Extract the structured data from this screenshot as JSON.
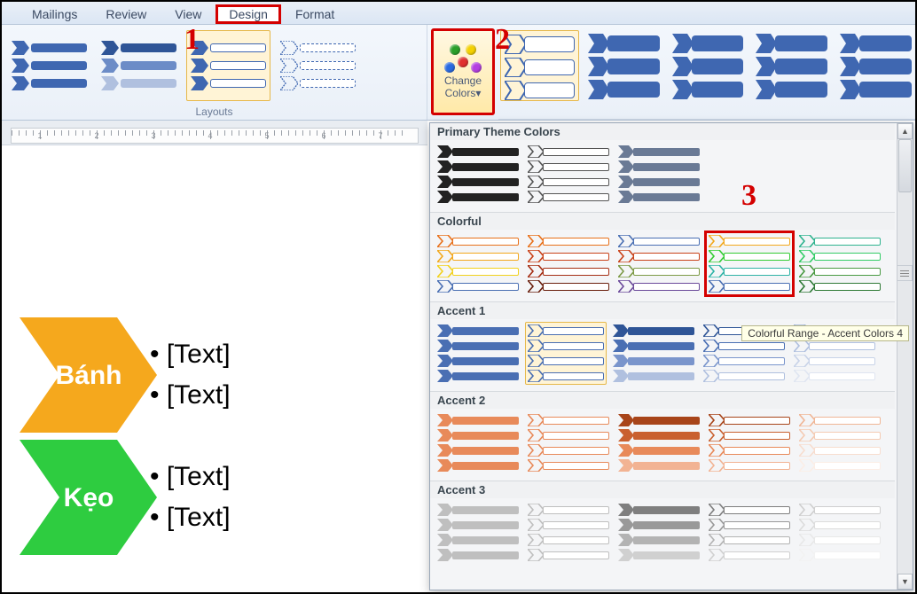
{
  "tabs": {
    "mailings": "Mailings",
    "review": "Review",
    "view": "View",
    "design": "Design",
    "format": "Format"
  },
  "ribbon": {
    "layouts_label": "Layouts",
    "change_colors_l1": "Change",
    "change_colors_l2": "Colors▾"
  },
  "annotations": {
    "n1": "1",
    "n2": "2",
    "n3": "3"
  },
  "panel": {
    "cat_primary": "Primary Theme Colors",
    "cat_colorful": "Colorful",
    "cat_accent1": "Accent 1",
    "cat_accent2": "Accent 2",
    "cat_accent3": "Accent 3",
    "tooltip": "Colorful Range - Accent Colors 4",
    "colorful": [
      [
        "#e8701a",
        "#f2a81d",
        "#f2d11d",
        "#4a6fb3"
      ],
      [
        "#e8701a",
        "#c9421a",
        "#a52f14",
        "#6a1f0d"
      ],
      [
        "#4a6fb3",
        "#c9421a",
        "#7d9a46",
        "#6b4a9a"
      ],
      [
        "#f2a81d",
        "#33cc33",
        "#2fb3a6",
        "#4a6fb3"
      ],
      [
        "#2fb38f",
        "#33cc66",
        "#4a9a43",
        "#2f7a36"
      ]
    ],
    "accent1": [
      [
        "#4a6fb3",
        "#4a6fb3",
        "#4a6fb3",
        "#4a6fb3",
        "fill"
      ],
      [
        "#4a6fb3",
        "#4a6fb3",
        "#4a6fb3",
        "#4a6fb3",
        "out"
      ],
      [
        "#2f5597",
        "#4a6fb3",
        "#7a95cc",
        "#b0c0df",
        "fill"
      ],
      [
        "#2f5597",
        "#4a6fb3",
        "#7a95cc",
        "#b0c0df",
        "out"
      ],
      [
        "#9ab0d6",
        "#b0c0df",
        "#c8d3e8",
        "#dfe5f1",
        "out"
      ]
    ],
    "accent2": [
      [
        "#e88a5a",
        "#e88a5a",
        "#e88a5a",
        "#e88a5a",
        "fill"
      ],
      [
        "#e88a5a",
        "#e88a5a",
        "#e88a5a",
        "#e88a5a",
        "out"
      ],
      [
        "#a8451a",
        "#c9602f",
        "#e88a5a",
        "#f2b393",
        "fill"
      ],
      [
        "#a8451a",
        "#c9602f",
        "#e88a5a",
        "#f2b393",
        "out"
      ],
      [
        "#f0b696",
        "#f4cbb3",
        "#f7ddcf",
        "#fbeee6",
        "out"
      ]
    ],
    "accent3": [
      [
        "#bfbfbf",
        "#bfbfbf",
        "#bfbfbf",
        "#bfbfbf",
        "fill"
      ],
      [
        "#bfbfbf",
        "#bfbfbf",
        "#bfbfbf",
        "#bfbfbf",
        "out"
      ],
      [
        "#7f7f7f",
        "#999",
        "#b3b3b3",
        "#d0d0d0",
        "fill"
      ],
      [
        "#7f7f7f",
        "#999",
        "#b3b3b3",
        "#d0d0d0",
        "out"
      ],
      [
        "#cfcfcf",
        "#dcdcdc",
        "#e8e8e8",
        "#f2f2f2",
        "out"
      ]
    ],
    "primary": [
      [
        "#222",
        "#222",
        "#222",
        "#222",
        "fill"
      ],
      [
        "#555",
        "#555",
        "#555",
        "#555",
        "out"
      ],
      [
        "#6a7a95",
        "#6a7a95",
        "#6a7a95",
        "#6a7a95",
        "fill"
      ]
    ]
  },
  "doc": {
    "item1_label": "Bánh",
    "item2_label": "Kẹo",
    "bullet": "•  [Text]"
  },
  "ruler_numbers": [
    "1",
    "2",
    "3",
    "4",
    "5",
    "6",
    "7"
  ]
}
